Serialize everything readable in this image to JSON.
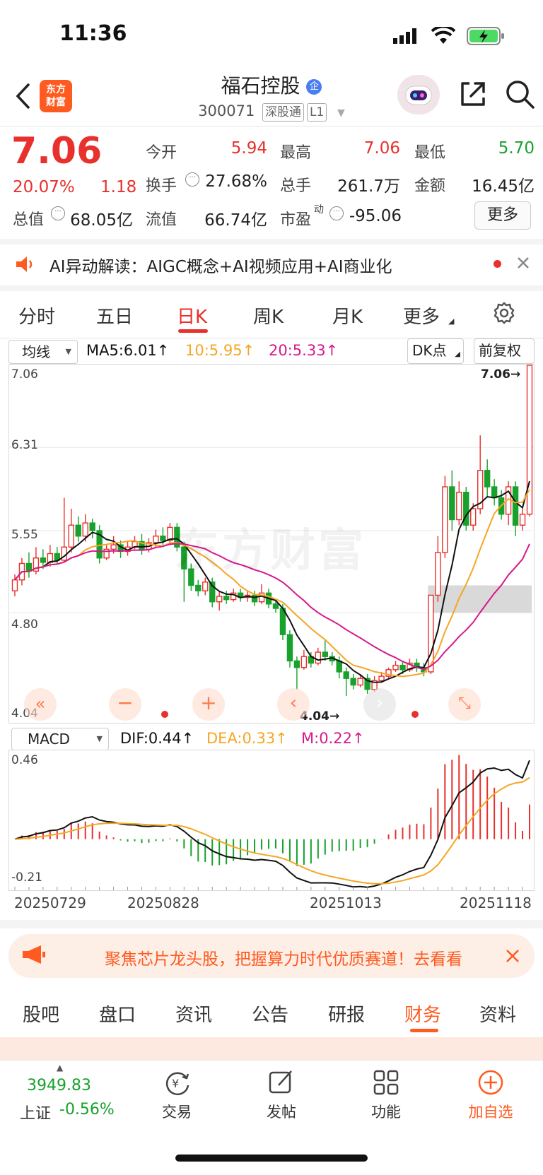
{
  "status_bar": {
    "time": "11:36"
  },
  "header": {
    "logo_line1": "东方",
    "logo_line2": "财富",
    "title": "福石控股",
    "title_badge": "企",
    "code": "300071",
    "tag1": "深股通",
    "tag2": "L1"
  },
  "quote": {
    "price": "7.06",
    "change_pct": "20.07%",
    "change": "1.18",
    "open_label": "今开",
    "open": "5.94",
    "high_label": "最高",
    "high": "7.06",
    "low_label": "最低",
    "low": "5.70",
    "turnover_label": "换手",
    "turnover": "27.68%",
    "volume_label": "总手",
    "volume": "261.7万",
    "amount_label": "金额",
    "amount": "16.45亿",
    "mktcap_label": "总值",
    "mktcap": "68.05亿",
    "float_label": "流值",
    "float": "66.74亿",
    "pe_label": "市盈",
    "pe_sup": "动",
    "pe": "-95.06",
    "more": "更多"
  },
  "ai_banner": {
    "text": "AI异动解读：AIGC概念+AI视频应用+AI商业化"
  },
  "chart_tabs": [
    {
      "label": "分时"
    },
    {
      "label": "五日"
    },
    {
      "label": "日K"
    },
    {
      "label": "周K"
    },
    {
      "label": "月K"
    },
    {
      "label": "更多"
    }
  ],
  "ma_row": {
    "selector": "均线",
    "ma5": "MA5:6.01",
    "ma10": "10:5.95",
    "ma20": "20:5.33",
    "dk": "DK点",
    "adjust": "前复权"
  },
  "kline_labels": {
    "p1": "7.06",
    "p2": "6.31",
    "p3": "5.55",
    "p4": "4.80",
    "p5": "4.04",
    "high_marker": "7.06→",
    "low_marker": "4.04→",
    "watermark": "东方财富"
  },
  "macd_row": {
    "selector": "MACD",
    "dif": "DIF:0.44",
    "dea": "DEA:0.33",
    "m": "M:0.22",
    "top": "0.46",
    "bottom": "-0.21"
  },
  "dates": [
    "20250729",
    "20250828",
    "20251013",
    "20251118"
  ],
  "colors": {
    "up": "#e8302c",
    "down": "#18a12c",
    "ma5": "#111111",
    "ma10": "#f5a623",
    "ma20": "#d6198c",
    "accent": "#ff5a1f"
  },
  "ad": {
    "text": "聚焦芯片龙头股，把握算力时代优质赛道！去看看"
  },
  "bottom_tabs": [
    {
      "label": "股吧"
    },
    {
      "label": "盘口"
    },
    {
      "label": "资讯"
    },
    {
      "label": "公告"
    },
    {
      "label": "研报"
    },
    {
      "label": "财务"
    },
    {
      "label": "资料"
    }
  ],
  "bottom_nav": {
    "index_value": "3949.83",
    "index_name": "上证",
    "index_change": "-0.56%",
    "trade": "交易",
    "post": "发帖",
    "func": "功能",
    "add": "加自选"
  },
  "chart_data": [
    {
      "type": "candlestick",
      "title": "",
      "ylim": [
        4.04,
        7.06
      ],
      "y_ticks": [
        7.06,
        6.31,
        5.55,
        4.8,
        4.04
      ],
      "x_ticks": [
        "20250729",
        "20250828",
        "20251013",
        "20251118"
      ],
      "candles": [
        [
          5.0,
          5.1,
          5.15,
          4.95
        ],
        [
          5.1,
          5.25,
          5.3,
          5.05
        ],
        [
          5.25,
          5.18,
          5.35,
          5.12
        ],
        [
          5.18,
          5.3,
          5.4,
          5.15
        ],
        [
          5.3,
          5.26,
          5.38,
          5.2
        ],
        [
          5.26,
          5.34,
          5.42,
          5.22
        ],
        [
          5.34,
          5.28,
          5.4,
          5.24
        ],
        [
          5.28,
          5.4,
          5.85,
          5.26
        ],
        [
          5.4,
          5.6,
          5.75,
          5.35
        ],
        [
          5.6,
          5.5,
          5.68,
          5.45
        ],
        [
          5.5,
          5.62,
          5.7,
          5.45
        ],
        [
          5.62,
          5.55,
          5.66,
          5.48
        ],
        [
          5.55,
          5.3,
          5.6,
          5.25
        ],
        [
          5.3,
          5.38,
          5.42,
          5.28
        ],
        [
          5.38,
          5.42,
          5.5,
          5.34
        ],
        [
          5.42,
          5.36,
          5.46,
          5.3
        ],
        [
          5.36,
          5.4,
          5.46,
          5.32
        ],
        [
          5.4,
          5.45,
          5.5,
          5.38
        ],
        [
          5.45,
          5.38,
          5.52,
          5.33
        ],
        [
          5.38,
          5.44,
          5.48,
          5.35
        ],
        [
          5.44,
          5.5,
          5.56,
          5.4
        ],
        [
          5.5,
          5.46,
          5.58,
          5.42
        ],
        [
          5.46,
          5.58,
          5.62,
          5.42
        ],
        [
          5.58,
          5.4,
          5.62,
          5.36
        ],
        [
          5.4,
          5.2,
          5.45,
          4.9
        ],
        [
          5.2,
          5.05,
          5.25,
          5.0
        ],
        [
          5.05,
          5.0,
          5.1,
          4.95
        ],
        [
          5.0,
          5.08,
          5.12,
          4.96
        ],
        [
          5.08,
          4.9,
          5.12,
          4.85
        ],
        [
          4.9,
          4.95,
          5.0,
          4.82
        ],
        [
          4.95,
          4.92,
          5.0,
          4.88
        ],
        [
          4.92,
          4.98,
          5.02,
          4.9
        ],
        [
          4.98,
          4.94,
          5.02,
          4.9
        ],
        [
          4.94,
          4.96,
          5.0,
          4.9
        ],
        [
          4.96,
          4.9,
          5.0,
          4.86
        ],
        [
          4.9,
          4.98,
          5.06,
          4.88
        ],
        [
          4.98,
          4.88,
          5.02,
          4.84
        ],
        [
          4.88,
          4.84,
          4.92,
          4.8
        ],
        [
          4.84,
          4.6,
          4.88,
          4.55
        ],
        [
          4.6,
          4.36,
          4.64,
          4.3
        ],
        [
          4.36,
          4.3,
          4.4,
          4.1
        ],
        [
          4.3,
          4.4,
          4.46,
          4.28
        ],
        [
          4.4,
          4.34,
          4.44,
          4.3
        ],
        [
          4.34,
          4.44,
          4.48,
          4.32
        ],
        [
          4.44,
          4.4,
          4.55,
          4.36
        ],
        [
          4.4,
          4.36,
          4.44,
          4.32
        ],
        [
          4.36,
          4.26,
          4.4,
          4.2
        ],
        [
          4.26,
          4.2,
          4.3,
          4.04
        ],
        [
          4.2,
          4.14,
          4.24,
          4.1
        ],
        [
          4.14,
          4.2,
          4.24,
          4.12
        ],
        [
          4.2,
          4.1,
          4.24,
          4.06
        ],
        [
          4.1,
          4.18,
          4.22,
          4.08
        ],
        [
          4.18,
          4.22,
          4.26,
          4.16
        ],
        [
          4.22,
          4.28,
          4.3,
          4.2
        ],
        [
          4.28,
          4.32,
          4.36,
          4.26
        ],
        [
          4.32,
          4.28,
          4.36,
          4.24
        ],
        [
          4.28,
          4.34,
          4.38,
          4.26
        ],
        [
          4.34,
          4.3,
          4.38,
          4.26
        ],
        [
          4.3,
          4.26,
          4.34,
          4.22
        ],
        [
          4.26,
          4.96,
          4.96,
          4.24
        ],
        [
          4.96,
          5.35,
          5.5,
          4.9
        ],
        [
          5.35,
          5.95,
          6.05,
          5.3
        ],
        [
          5.95,
          5.65,
          6.1,
          5.55
        ],
        [
          5.65,
          5.9,
          6.0,
          5.6
        ],
        [
          5.9,
          5.6,
          5.95,
          5.55
        ],
        [
          5.6,
          5.75,
          5.8,
          5.55
        ],
        [
          5.75,
          6.1,
          6.42,
          5.7
        ],
        [
          6.1,
          5.95,
          6.2,
          5.85
        ],
        [
          5.95,
          5.85,
          6.02,
          5.78
        ],
        [
          5.85,
          5.7,
          5.92,
          5.65
        ],
        [
          5.7,
          5.95,
          6.0,
          5.6
        ],
        [
          5.95,
          5.6,
          6.0,
          5.5
        ],
        [
          5.6,
          5.7,
          5.75,
          5.55
        ],
        [
          5.7,
          7.06,
          7.06,
          5.68
        ]
      ],
      "ma_series": [
        {
          "name": "MA5",
          "last": 6.01
        },
        {
          "name": "10",
          "last": 5.95
        },
        {
          "name": "20",
          "last": 5.33
        }
      ]
    },
    {
      "type": "bar",
      "title": "",
      "series": [
        {
          "name": "DIF",
          "last": 0.44
        },
        {
          "name": "DEA",
          "last": 0.33
        },
        {
          "name": "M",
          "last": 0.22
        }
      ],
      "ylim": [
        -0.21,
        0.46
      ]
    }
  ]
}
